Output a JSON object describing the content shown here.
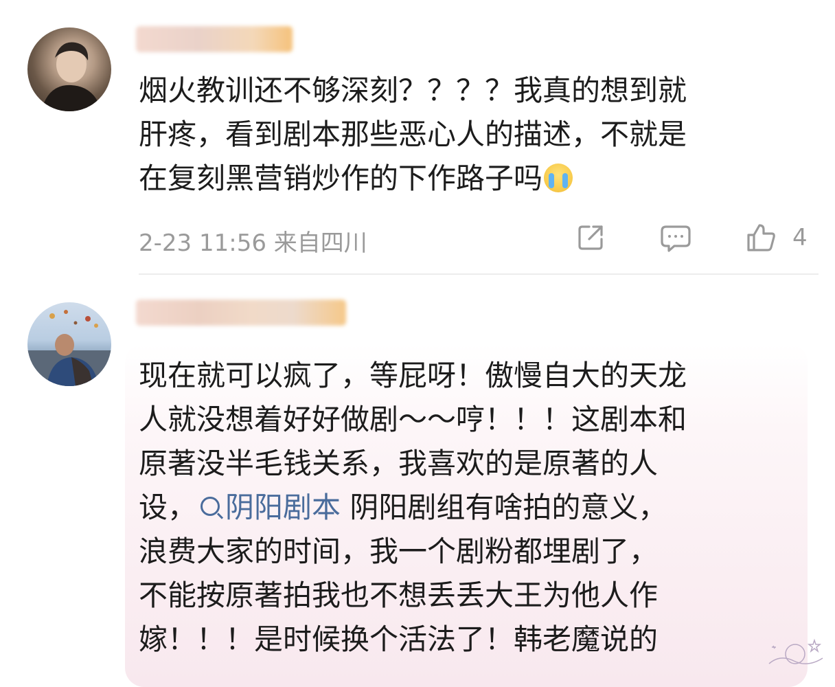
{
  "comments": [
    {
      "username_blurred": true,
      "body_lines": [
        "烟火教训还不够深刻？？？？我真的想到就",
        "肝疼，看到剧本那些恶心人的描述，不就是",
        "在复刻黑营销炒作的下作路子吗"
      ],
      "emoji": "crying-face",
      "time": "2-23 11:56",
      "location": "来自四川",
      "like_count": "4"
    },
    {
      "username_blurred": true,
      "body_lines": [
        "现在就可以疯了，等屁呀！傲慢自大的天龙",
        "人就没想着好好做剧～～哼！！！这剧本和",
        "原著没半毛钱关系，我喜欢的是原著的人",
        "设，",
        "阴阳剧组有啥拍的意义，",
        "浪费大家的时间，我一个剧粉都埋剧了，",
        "不能按原著拍我也不想丢丢大王为他人作",
        "嫁！！！是时候换个活法了！韩老魔说的"
      ],
      "search_link": "阴阳剧本"
    }
  ],
  "colors": {
    "text": "#1c1c1c",
    "meta": "#9a9a9a",
    "link": "#4a6c9c",
    "highlight": "#f8e8ee"
  },
  "icons": [
    "share-icon",
    "comment-icon",
    "like-icon",
    "search-icon"
  ]
}
